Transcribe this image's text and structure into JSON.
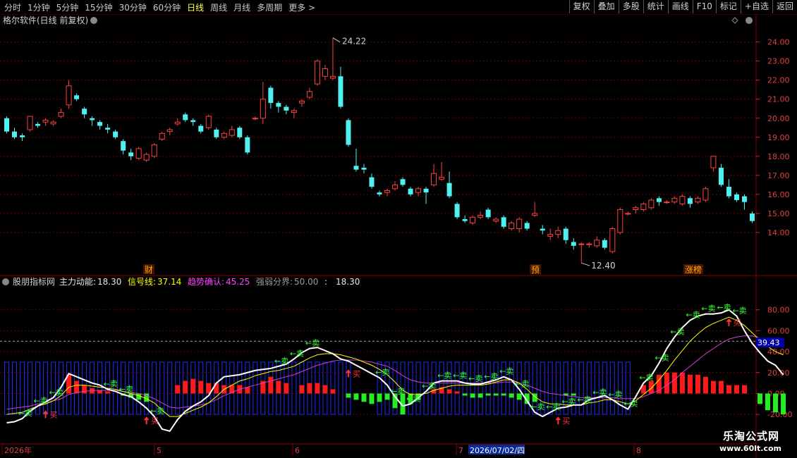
{
  "toolbar": {
    "periods": [
      "分时",
      "1分钟",
      "5分钟",
      "15分钟",
      "30分钟",
      "60分钟",
      "日线",
      "周线",
      "月线",
      "多周期",
      "更多 >"
    ],
    "active": "日线",
    "right_buttons": [
      "复权",
      "叠加",
      "多股",
      "统计",
      "画线",
      "F10",
      "标记",
      "+自选",
      "返回"
    ]
  },
  "main_title": "格尔软件(日线 前复权)",
  "indicator_header": {
    "name": "股朋指标网",
    "items": [
      {
        "label": "主力动能:",
        "value": "18.30",
        "color": "#e6e6e6"
      },
      {
        "label": "信号线:",
        "value": "37.14",
        "color": "#ffff00"
      },
      {
        "label": "趋势确认:",
        "value": "45.25",
        "color": "#ff44ff"
      },
      {
        "label": "强弱分界:",
        "value": "50.00",
        "color": "#9a9a9a"
      },
      {
        "label": ":",
        "value": "18.30",
        "color": "#e6e6e6"
      }
    ]
  },
  "markers": {
    "financial": "财",
    "forecast": "预",
    "limit_up": "涨榜",
    "high_label": "24.22",
    "low_label": "12.40",
    "level_label": "39.43"
  },
  "signals": {
    "buy": "买",
    "sell": "卖"
  },
  "dates": {
    "labels": [
      "2026年",
      "5",
      "6",
      "7",
      "8"
    ],
    "highlight": "2026/07/02/四"
  },
  "watermark": {
    "line1": "乐淘公式网",
    "line2": "www.60lt.com"
  },
  "chart_data": [
    {
      "type": "candlestick",
      "ylim": [
        12.0,
        24.8
      ],
      "y_ticks": [
        14,
        15,
        16,
        17,
        18,
        19,
        20,
        21,
        22,
        23,
        24
      ],
      "grid": true,
      "candles": [
        [
          20.0,
          19.3,
          20.1,
          19.2
        ],
        [
          19.3,
          19.0,
          19.5,
          18.9
        ],
        [
          19.1,
          19.0,
          19.2,
          18.8
        ],
        [
          19.4,
          20.1,
          20.1,
          19.3
        ],
        [
          19.7,
          19.6,
          19.8,
          19.5
        ],
        [
          19.8,
          19.9,
          20.0,
          19.6
        ],
        [
          19.7,
          19.8,
          19.9,
          19.6
        ],
        [
          20.1,
          20.3,
          20.5,
          20.0
        ],
        [
          20.7,
          21.7,
          22.0,
          20.5
        ],
        [
          21.2,
          21.0,
          21.3,
          20.9
        ],
        [
          20.5,
          20.2,
          20.6,
          20.0
        ],
        [
          20.0,
          19.9,
          20.1,
          19.6
        ],
        [
          19.8,
          19.6,
          19.9,
          19.4
        ],
        [
          19.5,
          19.4,
          19.7,
          19.2
        ],
        [
          19.3,
          19.0,
          19.4,
          18.9
        ],
        [
          18.8,
          18.3,
          18.9,
          18.1
        ],
        [
          18.2,
          18.0,
          18.4,
          17.8
        ],
        [
          17.9,
          18.4,
          18.5,
          17.8
        ],
        [
          17.8,
          18.1,
          18.2,
          17.7
        ],
        [
          18.0,
          18.6,
          18.7,
          17.9
        ],
        [
          18.9,
          19.2,
          19.3,
          18.8
        ],
        [
          19.3,
          19.4,
          19.5,
          19.1
        ],
        [
          19.7,
          19.8,
          20.0,
          19.6
        ],
        [
          20.2,
          19.9,
          20.3,
          19.8
        ],
        [
          19.9,
          19.8,
          20.0,
          19.6
        ],
        [
          19.6,
          19.3,
          19.7,
          19.2
        ],
        [
          19.5,
          20.1,
          20.2,
          19.4
        ],
        [
          19.4,
          19.0,
          19.5,
          18.9
        ],
        [
          19.0,
          19.2,
          19.3,
          18.9
        ],
        [
          19.1,
          19.4,
          19.6,
          19.0
        ],
        [
          19.5,
          19.0,
          19.6,
          18.9
        ],
        [
          19.0,
          18.2,
          19.1,
          18.1
        ],
        [
          20.0,
          20.0,
          20.1,
          19.9
        ],
        [
          20.0,
          21.0,
          21.9,
          19.7
        ],
        [
          21.6,
          20.8,
          21.7,
          20.5
        ],
        [
          20.8,
          20.6,
          20.9,
          20.3
        ],
        [
          20.6,
          20.4,
          20.7,
          20.2
        ],
        [
          20.3,
          20.4,
          20.5,
          20.0
        ],
        [
          20.8,
          20.9,
          21.0,
          20.6
        ],
        [
          21.1,
          21.4,
          21.6,
          21.0
        ],
        [
          21.8,
          23.0,
          23.1,
          21.7
        ],
        [
          22.2,
          22.6,
          22.8,
          22.0
        ],
        [
          22.1,
          22.2,
          24.22,
          22.0
        ],
        [
          22.2,
          20.6,
          22.7,
          20.5
        ],
        [
          19.9,
          18.6,
          20.0,
          18.5
        ],
        [
          17.5,
          17.3,
          18.4,
          17.2
        ],
        [
          17.4,
          17.3,
          17.6,
          17.1
        ],
        [
          16.9,
          16.4,
          17.1,
          16.3
        ],
        [
          16.1,
          16.0,
          16.2,
          15.9
        ],
        [
          16.1,
          16.2,
          16.3,
          15.9
        ],
        [
          16.3,
          16.5,
          16.7,
          16.2
        ],
        [
          16.8,
          16.5,
          16.9,
          16.4
        ],
        [
          16.3,
          16.0,
          16.4,
          15.9
        ],
        [
          16.1,
          16.3,
          16.4,
          15.9
        ],
        [
          16.3,
          16.1,
          16.4,
          15.5
        ],
        [
          16.5,
          17.1,
          17.6,
          16.4
        ],
        [
          16.8,
          16.9,
          17.7,
          16.7
        ],
        [
          16.6,
          15.9,
          17.2,
          15.8
        ],
        [
          15.5,
          14.8,
          15.6,
          14.7
        ],
        [
          14.7,
          14.6,
          14.9,
          14.5
        ],
        [
          14.5,
          14.8,
          14.9,
          14.4
        ],
        [
          14.8,
          14.9,
          15.1,
          14.7
        ],
        [
          15.2,
          14.8,
          15.3,
          14.7
        ],
        [
          14.6,
          14.7,
          14.8,
          14.5
        ],
        [
          14.8,
          14.3,
          14.9,
          14.2
        ],
        [
          14.2,
          14.5,
          14.6,
          14.1
        ],
        [
          14.2,
          14.7,
          14.8,
          14.0
        ],
        [
          14.5,
          14.2,
          14.6,
          14.1
        ],
        [
          14.9,
          15.0,
          15.6,
          14.8
        ],
        [
          14.2,
          14.1,
          14.4,
          13.9
        ],
        [
          13.8,
          13.9,
          14.2,
          13.6
        ],
        [
          13.9,
          14.1,
          14.3,
          13.7
        ],
        [
          14.2,
          13.6,
          14.3,
          13.4
        ],
        [
          13.5,
          13.3,
          13.7,
          13.1
        ],
        [
          13.4,
          13.4,
          13.5,
          12.4
        ],
        [
          13.4,
          13.4,
          13.5,
          13.2
        ],
        [
          13.3,
          13.6,
          13.8,
          13.2
        ],
        [
          13.6,
          13.2,
          13.7,
          13.1
        ],
        [
          13.0,
          14.2,
          14.3,
          12.9
        ],
        [
          14.0,
          15.2,
          15.3,
          13.9
        ],
        [
          15.0,
          15.0,
          15.1,
          14.9
        ],
        [
          15.2,
          15.3,
          15.4,
          15.0
        ],
        [
          15.2,
          15.5,
          15.6,
          15.1
        ],
        [
          15.3,
          15.7,
          15.8,
          15.2
        ],
        [
          15.8,
          15.6,
          15.9,
          15.4
        ],
        [
          15.6,
          15.6,
          15.7,
          15.5
        ],
        [
          15.6,
          15.8,
          15.9,
          15.5
        ],
        [
          15.5,
          15.9,
          16.0,
          15.4
        ],
        [
          15.8,
          15.5,
          15.9,
          15.3
        ],
        [
          15.6,
          15.8,
          15.9,
          15.5
        ],
        [
          15.7,
          16.3,
          16.4,
          15.6
        ],
        [
          17.4,
          18.0,
          18.0,
          17.2
        ],
        [
          17.4,
          16.5,
          17.6,
          16.4
        ],
        [
          16.4,
          15.9,
          16.8,
          15.8
        ],
        [
          16.0,
          15.7,
          16.1,
          15.6
        ],
        [
          15.9,
          15.6,
          16.0,
          15.2
        ],
        [
          15.0,
          14.6,
          15.1,
          14.5
        ]
      ]
    },
    {
      "type": "line",
      "ylim": [
        -28,
        100
      ],
      "y_ticks": [
        -20,
        0,
        20,
        40,
        60,
        80
      ],
      "threshold": 50,
      "series": [
        {
          "name": "主力动能",
          "color": "#ffffff",
          "values": [
            -28,
            -27,
            -24,
            -17,
            -12,
            -8,
            -4,
            6,
            19,
            16,
            13,
            10,
            8,
            4,
            2,
            -1,
            -3,
            -8,
            -14,
            -22,
            -34,
            -36,
            -25,
            -17,
            -12,
            -8,
            -2,
            10,
            16,
            17,
            18,
            20,
            22,
            23,
            24,
            26,
            28,
            33,
            39,
            43,
            44,
            41,
            38,
            33,
            31,
            27,
            23,
            19,
            15,
            8,
            -3,
            -12,
            -10,
            -4,
            2,
            10,
            12,
            12,
            12,
            10,
            9,
            9,
            11,
            13,
            16,
            13,
            4,
            -7,
            -18,
            -22,
            -18,
            -14,
            -13,
            -11,
            -11,
            -6,
            -4,
            -2,
            -6,
            -11,
            -15,
            -3,
            10,
            17,
            29,
            43,
            54,
            63,
            70,
            74,
            76,
            76,
            77,
            80,
            74,
            60,
            48,
            39,
            31,
            27,
            18
          ],
          "buy": [
            5,
            18,
            44,
            71,
            93
          ],
          "sell": [
            2,
            3,
            4,
            5,
            6,
            12,
            13,
            14,
            15,
            18,
            19,
            20,
            35,
            36,
            37,
            38,
            39,
            47,
            48,
            49,
            50,
            51,
            52,
            53,
            54,
            55,
            56,
            57,
            58,
            59,
            60,
            61,
            62,
            63,
            64,
            65,
            66,
            67,
            68,
            69,
            70,
            71,
            72,
            73,
            74,
            75,
            76,
            77,
            78,
            79,
            80,
            81,
            82,
            83,
            84,
            85,
            86,
            87,
            88,
            89,
            90,
            91,
            92,
            93,
            94
          ]
        },
        {
          "name": "信号线",
          "color": "#ffff00",
          "values": [
            -20,
            -19,
            -18,
            -15,
            -12,
            -10,
            -7,
            -2,
            6,
            8,
            8,
            7,
            6,
            5,
            4,
            2,
            0,
            -2,
            -5,
            -9,
            -16,
            -22,
            -22,
            -19,
            -16,
            -13,
            -9,
            -3,
            4,
            8,
            12,
            14,
            17,
            19,
            21,
            22,
            24,
            26,
            30,
            34,
            37,
            38,
            38,
            37,
            35,
            33,
            30,
            27,
            23,
            18,
            11,
            3,
            -1,
            -1,
            0,
            3,
            5,
            7,
            8,
            8,
            8,
            8,
            9,
            11,
            13,
            13,
            10,
            4,
            -3,
            -8,
            -10,
            -10,
            -11,
            -11,
            -11,
            -9,
            -8,
            -6,
            -6,
            -8,
            -10,
            -7,
            -1,
            5,
            13,
            22,
            32,
            41,
            50,
            57,
            63,
            67,
            70,
            73,
            70,
            65,
            58,
            51,
            45,
            40,
            37
          ],
          "buy": [],
          "sell": []
        },
        {
          "name": "趋势确认",
          "color": "#d040d0",
          "values": [
            -15,
            -14,
            -13,
            -12,
            -10,
            -9,
            -7,
            -5,
            -1,
            1,
            2,
            3,
            3,
            3,
            3,
            2,
            1,
            0,
            -2,
            -5,
            -9,
            -13,
            -14,
            -13,
            -12,
            -11,
            -9,
            -6,
            -2,
            1,
            4,
            6,
            8,
            10,
            12,
            14,
            16,
            18,
            21,
            24,
            27,
            29,
            31,
            32,
            32,
            32,
            31,
            30,
            28,
            26,
            22,
            17,
            13,
            11,
            10,
            10,
            10,
            10,
            10,
            10,
            10,
            10,
            10,
            10,
            11,
            11,
            10,
            8,
            5,
            2,
            0,
            -1,
            -2,
            -3,
            -4,
            -4,
            -4,
            -4,
            -4,
            -5,
            -5,
            -5,
            -3,
            0,
            3,
            8,
            13,
            20,
            26,
            32,
            38,
            43,
            48,
            52,
            54,
            55,
            55,
            53,
            50,
            47,
            45
          ],
          "buy": [],
          "sell": []
        }
      ],
      "bars": [
        0,
        0,
        0,
        0,
        0,
        0,
        0,
        0,
        18,
        12,
        8,
        5,
        3,
        2,
        0,
        -2,
        -4,
        -6,
        -8,
        0,
        0,
        0,
        8,
        12,
        14,
        12,
        10,
        10,
        8,
        8,
        8,
        6,
        0,
        12,
        16,
        12,
        10,
        0,
        8,
        10,
        10,
        8,
        4,
        0,
        -4,
        -6,
        -8,
        -10,
        -8,
        -6,
        -14,
        -20,
        -10,
        -6,
        0,
        4,
        6,
        4,
        2,
        -2,
        -4,
        -4,
        -2,
        -2,
        -2,
        -4,
        -6,
        -10,
        -8,
        0,
        0,
        0,
        -2,
        -2,
        0,
        0,
        0,
        0,
        0,
        0,
        0,
        0,
        8,
        12,
        18,
        20,
        20,
        20,
        18,
        18,
        16,
        12,
        12,
        8,
        8,
        8,
        0,
        -10,
        -16,
        -18,
        -20
      ]
    }
  ]
}
